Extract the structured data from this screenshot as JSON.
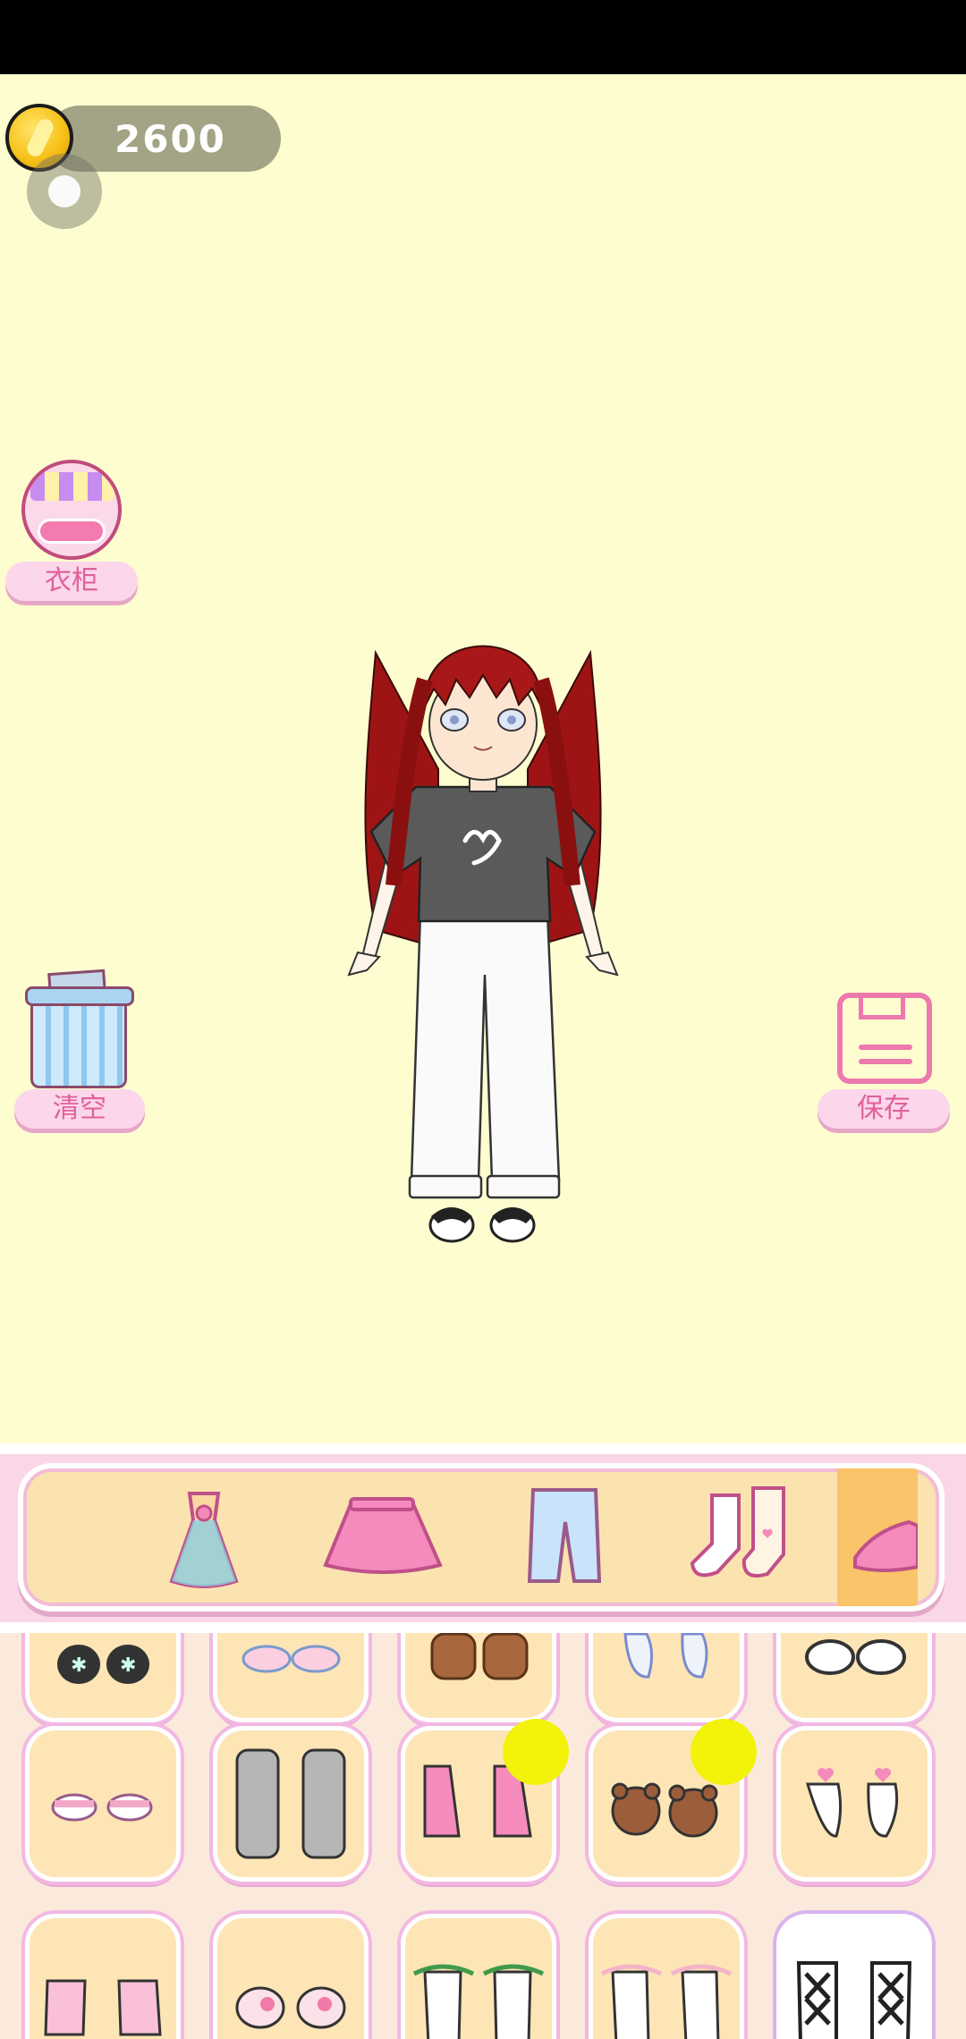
{
  "coins": {
    "value": "2600"
  },
  "side_buttons": {
    "wardrobe_label": "衣柜",
    "clear_label": "清空",
    "save_label": "保存"
  },
  "categories": [
    {
      "icon": "dress-icon"
    },
    {
      "icon": "skirt-icon"
    },
    {
      "icon": "pants-icon"
    },
    {
      "icon": "socks-icon"
    },
    {
      "icon": "shoes-icon",
      "active": true
    }
  ],
  "items": {
    "rows": 3,
    "new_badges": 2,
    "selected_item": "black-sneakers"
  },
  "colors": {
    "background": "#fdfdd0",
    "accent_pink": "#ee79ad",
    "label_text": "#e0609c",
    "tile_fill": "#fde5b6",
    "badge": "#f2f20a"
  }
}
